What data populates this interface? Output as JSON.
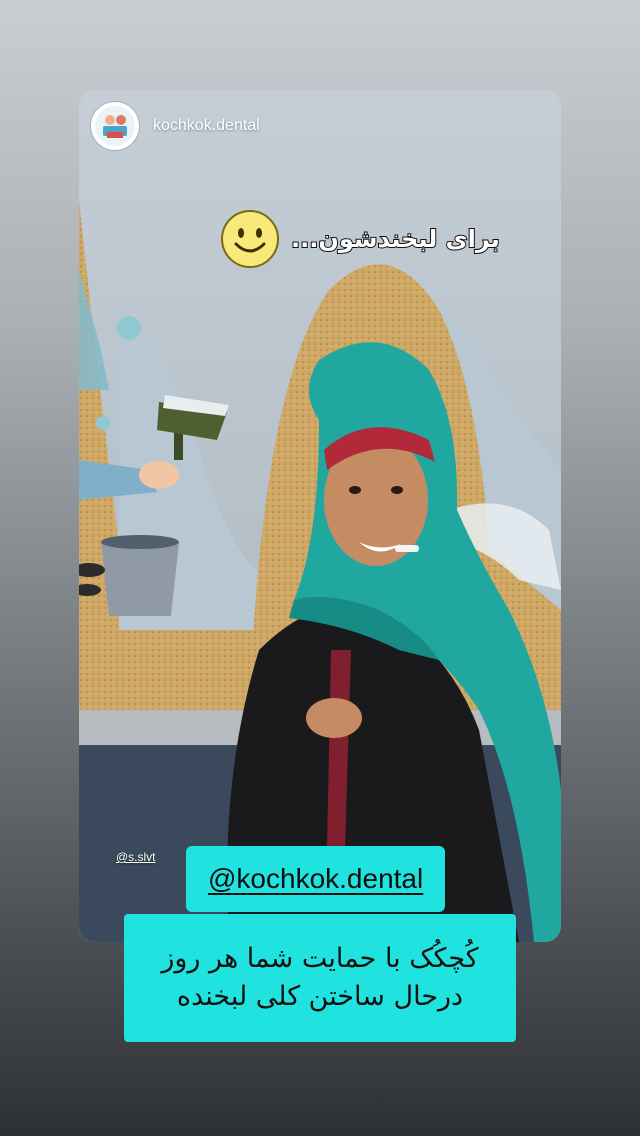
{
  "story": {
    "username": "kochkok.dental",
    "avatar_icon": "clinic-logo-icon",
    "title_sticker": "برای لبخندشون...",
    "emoji_icon": "smiley-face-icon",
    "credit_tag": "@s.slvt",
    "mention": "@kochkok.dental",
    "caption_lines": [
      "کُچکُک با حمایت شما هر روز",
      "درحال ساختن کلی لبخنده"
    ]
  },
  "colors": {
    "sticker_bg": "#20e3df",
    "scarf": "#1fa7a0",
    "wall": "#b9c3cc"
  }
}
